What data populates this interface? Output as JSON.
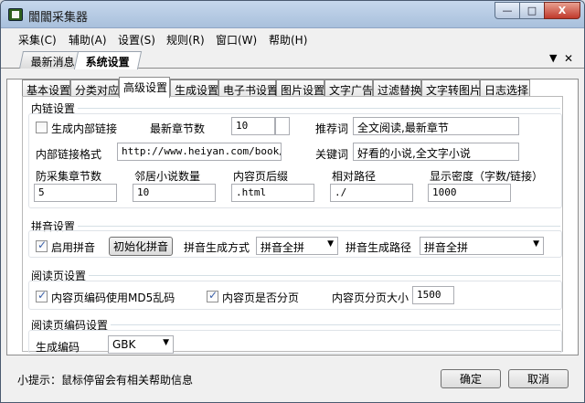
{
  "window": {
    "title": "闟闟采集器",
    "controls": {
      "minimize": "—",
      "maximize": "□",
      "close": "X"
    }
  },
  "menu": [
    "采集(C)",
    "辅助(A)",
    "设置(S)",
    "规则(R)",
    "窗口(W)",
    "帮助(H)"
  ],
  "doc_tabs": [
    "最新消息",
    "系统设置"
  ],
  "doc_controls": {
    "dropdown": "▼",
    "close": "✕"
  },
  "settings_tabs": [
    "基本设置",
    "分类对应",
    "高级设置",
    "生成设置",
    "电子书设置",
    "图片设置",
    "文字广告",
    "过滤替换",
    "文字转图片",
    "日志选择"
  ],
  "active_settings_tab": "高级设置",
  "inner_link": {
    "section_title": "内链设置",
    "gen_inner_link_label": "生成内部链接",
    "gen_inner_link_checked": false,
    "latest_chapters_label": "最新章节数",
    "latest_chapters_value": "10",
    "recommend_label": "推荐词",
    "recommend_value": "全文阅读,最新章节",
    "inner_link_format_label": "内部链接格式",
    "inner_link_format_value": "http://www.heiyan.com/book/[Nove]",
    "keyword_label": "关键词",
    "keyword_value": "好看的小说,全文字小说",
    "anti_collect_label": "防采集章节数",
    "anti_collect_value": "5",
    "neighbor_label": "邻居小说数量",
    "neighbor_value": "10",
    "suffix_label": "内容页后缀",
    "suffix_value": ".html",
    "relative_path_label": "相对路径",
    "relative_path_value": "./",
    "density_label": "显示密度（字数/链接）",
    "density_value": "1000"
  },
  "pinyin": {
    "section_title": "拼音设置",
    "enable_label": "启用拼音",
    "enable_checked": true,
    "init_button": "初始化拼音",
    "mode_label": "拼音生成方式",
    "mode_value": "拼音全拼",
    "path_label": "拼音生成路径",
    "path_value": "拼音全拼"
  },
  "reader": {
    "section_title": "阅读页设置",
    "md5_label": "内容页编码使用MD5乱码",
    "md5_checked": true,
    "paging_label": "内容页是否分页",
    "paging_checked": true,
    "page_size_label": "内容页分页大小",
    "page_size_value": "1500"
  },
  "encoding": {
    "section_title": "阅读页编码设置",
    "gen_label": "生成编码",
    "gen_value": "GBK"
  },
  "footer": {
    "tip": "小提示：鼠标停留会有相关帮助信息",
    "ok_button": "确定",
    "cancel_button": "取消"
  }
}
